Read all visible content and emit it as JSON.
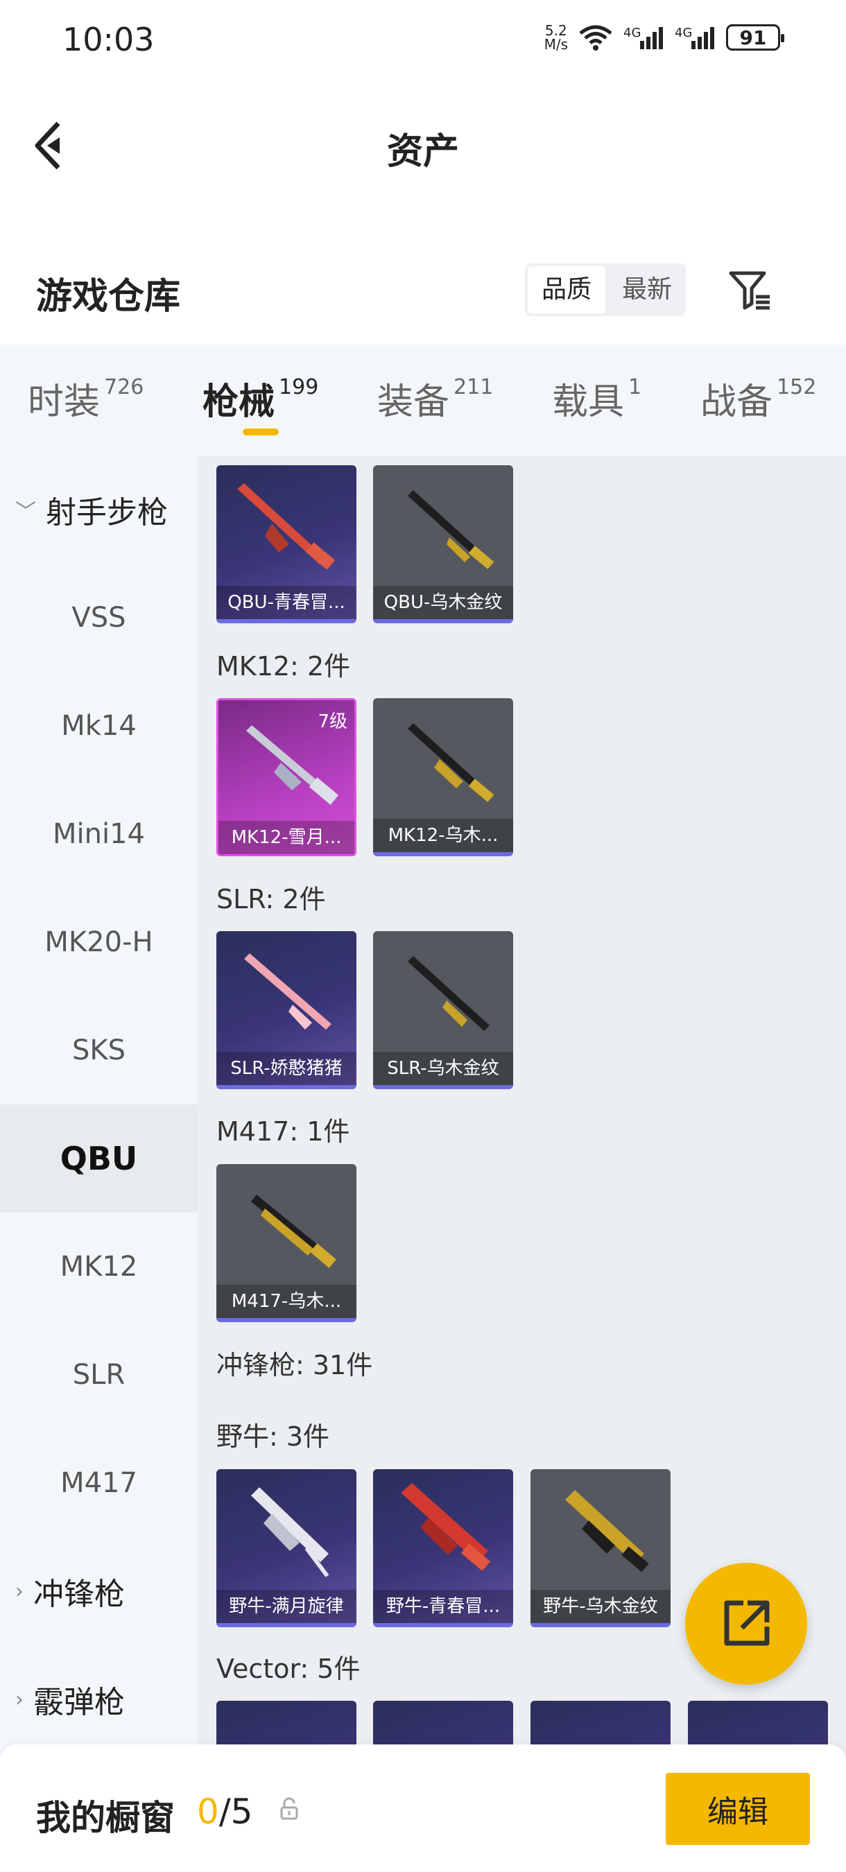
{
  "status": {
    "time": "10:03",
    "speed_value": "5.2",
    "speed_unit": "M/s",
    "net1": "4G",
    "net2": "4G",
    "battery": "91"
  },
  "header": {
    "title": "资产"
  },
  "warehouse": {
    "title": "游戏仓库",
    "sort_quality": "品质",
    "sort_latest": "最新"
  },
  "tabs": [
    {
      "label": "时装",
      "count": "726"
    },
    {
      "label": "枪械",
      "count": "199"
    },
    {
      "label": "装备",
      "count": "211"
    },
    {
      "label": "载具",
      "count": "1"
    },
    {
      "label": "战备",
      "count": "152"
    }
  ],
  "sidebar": [
    {
      "label": "射手步枪",
      "type": "group",
      "expanded": true
    },
    {
      "label": "VSS"
    },
    {
      "label": "Mk14"
    },
    {
      "label": "Mini14"
    },
    {
      "label": "MK20-H"
    },
    {
      "label": "SKS"
    },
    {
      "label": "QBU",
      "active": true
    },
    {
      "label": "MK12"
    },
    {
      "label": "SLR"
    },
    {
      "label": "M417"
    },
    {
      "label": "冲锋枪",
      "type": "group"
    },
    {
      "label": "霰弹枪",
      "type": "group"
    }
  ],
  "sections": [
    {
      "title": "",
      "items": [
        {
          "name": "QBU-青春冒...",
          "style": "purple"
        },
        {
          "name": "QBU-乌木金纹",
          "style": "gray"
        }
      ]
    },
    {
      "title": "MK12: 2件",
      "items": [
        {
          "name": "MK12-雪月...",
          "style": "pink",
          "level": "7级"
        },
        {
          "name": "MK12-乌木...",
          "style": "gray"
        }
      ]
    },
    {
      "title": "SLR: 2件",
      "items": [
        {
          "name": "SLR-娇憨猪猪",
          "style": "purple"
        },
        {
          "name": "SLR-乌木金纹",
          "style": "gray"
        }
      ]
    },
    {
      "title": "M417: 1件",
      "items": [
        {
          "name": "M417-乌木...",
          "style": "gray"
        }
      ]
    },
    {
      "title": "冲锋枪: 31件",
      "items": []
    },
    {
      "title": "野牛: 3件",
      "items": [
        {
          "name": "野牛-满月旋律",
          "style": "purple"
        },
        {
          "name": "野牛-青春冒...",
          "style": "purple"
        },
        {
          "name": "野牛-乌木金纹",
          "style": "gray"
        }
      ]
    },
    {
      "title": "Vector: 5件",
      "items": []
    }
  ],
  "bottom": {
    "label": "我的橱窗",
    "current": "0",
    "total": "/5",
    "edit": "编辑"
  },
  "colors": {
    "accent": "#f5b800",
    "card_purple": "#3a3577",
    "card_gray": "#55585e",
    "card_pink": "#b640c0"
  }
}
